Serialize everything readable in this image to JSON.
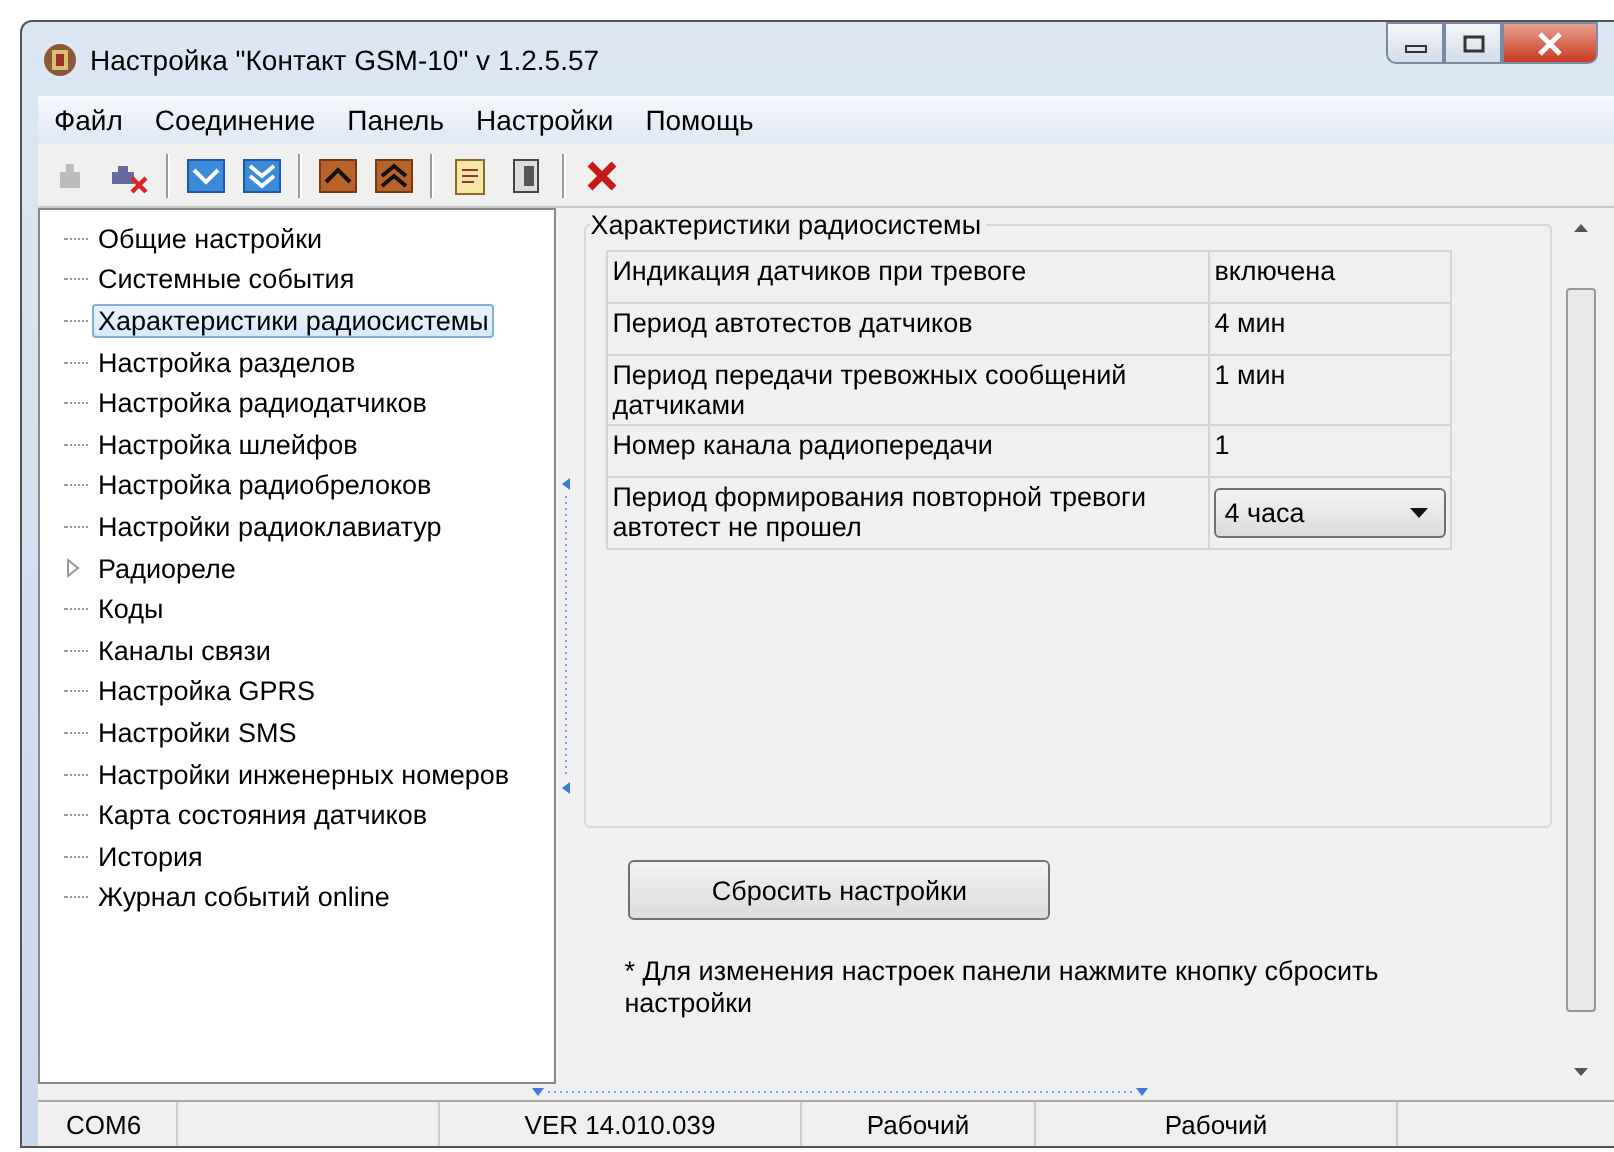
{
  "window": {
    "title": "Настройка \"Контакт GSM-10\" v 1.2.5.57"
  },
  "menu": [
    "Файл",
    "Соединение",
    "Панель",
    "Настройки",
    "Помощь"
  ],
  "toolbar": [
    {
      "kind": "connect",
      "disabled": true
    },
    {
      "kind": "disconnect",
      "disabled": false
    },
    {
      "kind": "sep"
    },
    {
      "kind": "down",
      "disabled": false
    },
    {
      "kind": "down-all",
      "disabled": false
    },
    {
      "kind": "sep"
    },
    {
      "kind": "up",
      "disabled": false
    },
    {
      "kind": "up-all",
      "disabled": false
    },
    {
      "kind": "sep"
    },
    {
      "kind": "notes",
      "disabled": false
    },
    {
      "kind": "device",
      "disabled": false
    },
    {
      "kind": "sep"
    },
    {
      "kind": "delete",
      "disabled": false
    }
  ],
  "tree": [
    {
      "label": "Общие настройки",
      "selected": false
    },
    {
      "label": "Системные события",
      "selected": false
    },
    {
      "label": "Характеристики радиосистемы",
      "selected": true
    },
    {
      "label": "Настройка разделов",
      "selected": false
    },
    {
      "label": "Настройка радиодатчиков",
      "selected": false
    },
    {
      "label": "Настройка шлейфов",
      "selected": false
    },
    {
      "label": "Настройка радиобрелоков",
      "selected": false
    },
    {
      "label": "Настройки радиоклавиатур",
      "selected": false
    },
    {
      "label": "Радиореле",
      "selected": false,
      "expanded": false
    },
    {
      "label": "Коды",
      "selected": false
    },
    {
      "label": "Каналы связи",
      "selected": false
    },
    {
      "label": "Настройка GPRS",
      "selected": false
    },
    {
      "label": "Настройки SMS",
      "selected": false
    },
    {
      "label": "Настройки инженерных номеров",
      "selected": false
    },
    {
      "label": "Карта состояния датчиков",
      "selected": false
    },
    {
      "label": "История",
      "selected": false
    },
    {
      "label": "Журнал событий online",
      "selected": false
    }
  ],
  "group": {
    "title": "Характеристики радиосистемы",
    "rows": [
      {
        "kind": "text",
        "label": "Индикация датчиков при тревоге",
        "value": "включена"
      },
      {
        "kind": "text",
        "label": "Период автотестов датчиков",
        "value": "4 мин"
      },
      {
        "kind": "text",
        "label": "Период передачи тревожных сообщений датчиками",
        "value": "1 мин"
      },
      {
        "kind": "text",
        "label": "Номер канала радиопередачи",
        "value": "1"
      },
      {
        "kind": "dropdown",
        "label": "Период формирования повторной тревоги автотест не прошел",
        "value": "4 часа"
      }
    ]
  },
  "reset_button": "Сбросить настройки",
  "note": "* Для изменения настроек панели нажмите кнопку сбросить настройки",
  "status_bar": [
    "COM6",
    "VER 14.010.039",
    "Рабочий",
    "Рабочий"
  ]
}
